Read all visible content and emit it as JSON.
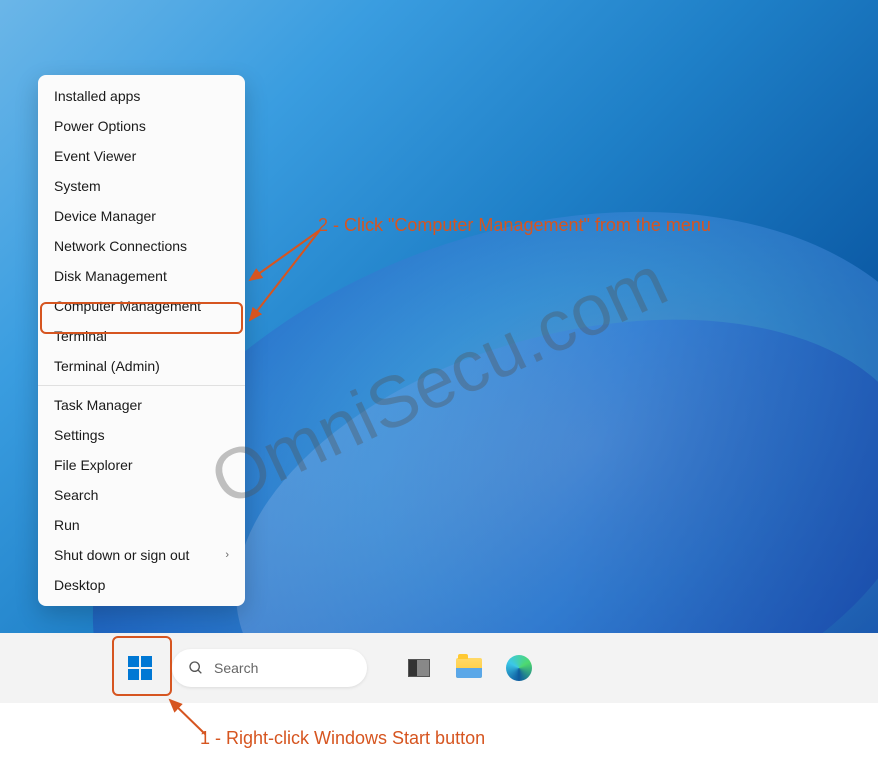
{
  "watermark": "OmniSecu.com",
  "menu": {
    "items": [
      "Installed apps",
      "Power Options",
      "Event Viewer",
      "System",
      "Device Manager",
      "Network Connections",
      "Disk Management",
      "Computer Management",
      "Terminal",
      "Terminal (Admin)",
      "Task Manager",
      "Settings",
      "File Explorer",
      "Search",
      "Run",
      "Shut down or sign out",
      "Desktop"
    ]
  },
  "search": {
    "placeholder": "Search"
  },
  "annotations": {
    "step1": "1 - Right-click Windows Start button",
    "step2": "2 - Click \"Computer Management\" from the menu"
  },
  "colors": {
    "annotation": "#d65520"
  }
}
